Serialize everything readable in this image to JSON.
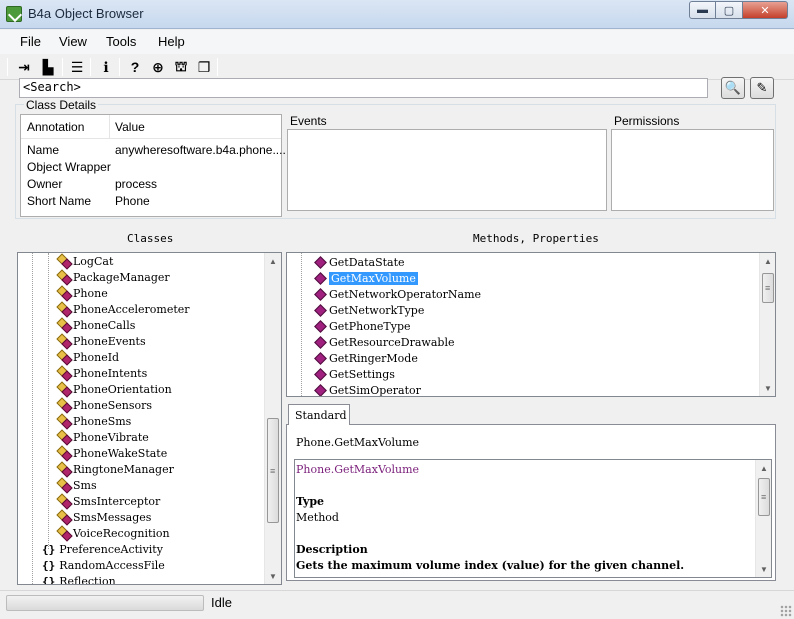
{
  "window": {
    "title": "B4a Object Browser",
    "minimize": "▬",
    "maximize": "▢",
    "close": "✕"
  },
  "menu": [
    "File",
    "View",
    "Tools",
    "Help"
  ],
  "toolbar": {
    "icons": [
      "exit-icon",
      "new-file-icon",
      "list-icon",
      "info-icon",
      "help-icon",
      "web-icon",
      "gift-icon",
      "copy-icon"
    ]
  },
  "search": {
    "value": "<Search>"
  },
  "class_details": {
    "label": "Class Details",
    "col_annotation": "Annotation",
    "col_value": "Value",
    "rows": [
      {
        "annotation": "Name",
        "value": "anywheresoftware.b4a.phone...."
      },
      {
        "annotation": "Object Wrapper",
        "value": ""
      },
      {
        "annotation": "Owner",
        "value": "process"
      },
      {
        "annotation": "Short Name",
        "value": "Phone"
      }
    ]
  },
  "events": {
    "label": "Events"
  },
  "permissions": {
    "label": "Permissions"
  },
  "classes": {
    "label": "Classes",
    "items": [
      "LogCat",
      "PackageManager",
      "Phone",
      "PhoneAccelerometer",
      "PhoneCalls",
      "PhoneEvents",
      "PhoneId",
      "PhoneIntents",
      "PhoneOrientation",
      "PhoneSensors",
      "PhoneSms",
      "PhoneVibrate",
      "PhoneWakeState",
      "RingtoneManager",
      "Sms",
      "SmsInterceptor",
      "SmsMessages",
      "VoiceRecognition"
    ],
    "top_items": [
      "PreferenceActivity",
      "RandomAccessFile",
      "Reflection"
    ],
    "brace": "{}"
  },
  "methods": {
    "label": "Methods, Properties",
    "items": [
      "GetDataState",
      "GetMaxVolume",
      "GetNetworkOperatorName",
      "GetNetworkType",
      "GetPhoneType",
      "GetResourceDrawable",
      "GetRingerMode",
      "GetSettings",
      "GetSimOperator"
    ],
    "selected": "GetMaxVolume"
  },
  "doc": {
    "tab": "Standard",
    "header": "Phone.GetMaxVolume",
    "lines": [
      {
        "text": "Phone.GetMaxVolume",
        "style": "purple"
      },
      {
        "text": "",
        "style": "normal"
      },
      {
        "text": "Type",
        "style": "bold"
      },
      {
        "text": "Method",
        "style": "normal"
      },
      {
        "text": "",
        "style": "normal"
      },
      {
        "text": "Description",
        "style": "bold"
      },
      {
        "text": "Gets the maximum volume index (value) for the given channel.",
        "style": "bold"
      }
    ]
  },
  "status": {
    "text": "Idle"
  },
  "colors": {
    "selection": "#3399ff",
    "doc_title": "#7a1e7a"
  }
}
